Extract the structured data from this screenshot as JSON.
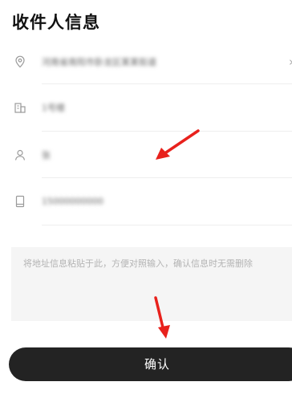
{
  "page": {
    "title": "收件人信息"
  },
  "fields": [
    {
      "name": "address",
      "icon": "location-pin-icon",
      "value": "河南省南阳市卧龙区某某街道"
    },
    {
      "name": "building",
      "icon": "building-icon",
      "value": "1号楼"
    },
    {
      "name": "recipient",
      "icon": "person-icon",
      "value": "张"
    },
    {
      "name": "phone",
      "icon": "phone-icon",
      "value": "15000000000"
    }
  ],
  "paste_area": {
    "placeholder": "将地址信息粘贴于此，方便对照输入，确认信息时无需删除"
  },
  "confirm_button": {
    "label": "确认"
  },
  "colors": {
    "button_bg": "#232323",
    "annotation_arrow": "#e8211c",
    "muted": "#9a9a9a"
  }
}
